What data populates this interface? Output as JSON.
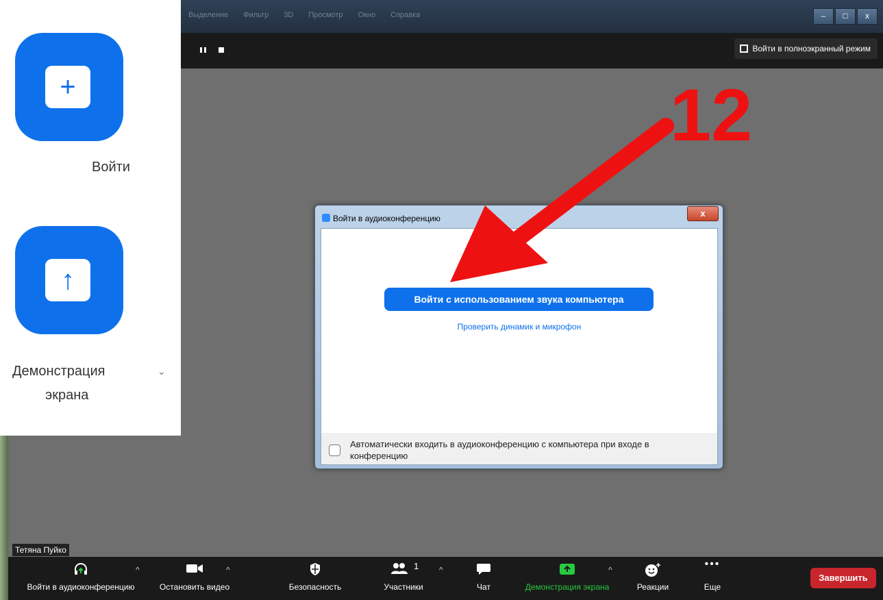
{
  "window": {
    "menu": [
      "Выделение",
      "Фильтр",
      "3D",
      "Просмотр",
      "Окно",
      "Справка"
    ],
    "minimize": "–",
    "maximize": "□",
    "close": "x"
  },
  "topbar": {
    "fullscreen_label": "Войти в полноэкранный режим"
  },
  "participant_name": "Тетяна Пуйко",
  "toolbar": {
    "join_audio": "Войти в аудиоконференцию",
    "stop_video": "Остановить видео",
    "security": "Безопасность",
    "participants": "Участники",
    "participants_count": "1",
    "chat": "Чат",
    "share_screen": "Демонстрация экрана",
    "reactions": "Реакции",
    "more": "Еще",
    "end": "Завершить",
    "share_color": "#27c93f"
  },
  "dialog": {
    "title": "Войти в аудиоконференцию",
    "close": "x",
    "join_button": "Войти с использованием звука компьютера",
    "test_link": "Проверить динамик и микрофон",
    "auto_join_label": "Автоматически входить в аудиоконференцию с компьютера при входе в конференцию",
    "auto_join_checked": false
  },
  "inset": {
    "join_label": "Войти",
    "share_label_line1": "Демонстрация",
    "share_label_line2": "экрана",
    "join_symbol": "+",
    "share_symbol": "↑",
    "chevron": "⌄"
  },
  "annotation": {
    "number": "12",
    "color": "#ee1111"
  },
  "colors": {
    "zoom_blue": "#0e71eb",
    "end_red": "#c8252c"
  }
}
